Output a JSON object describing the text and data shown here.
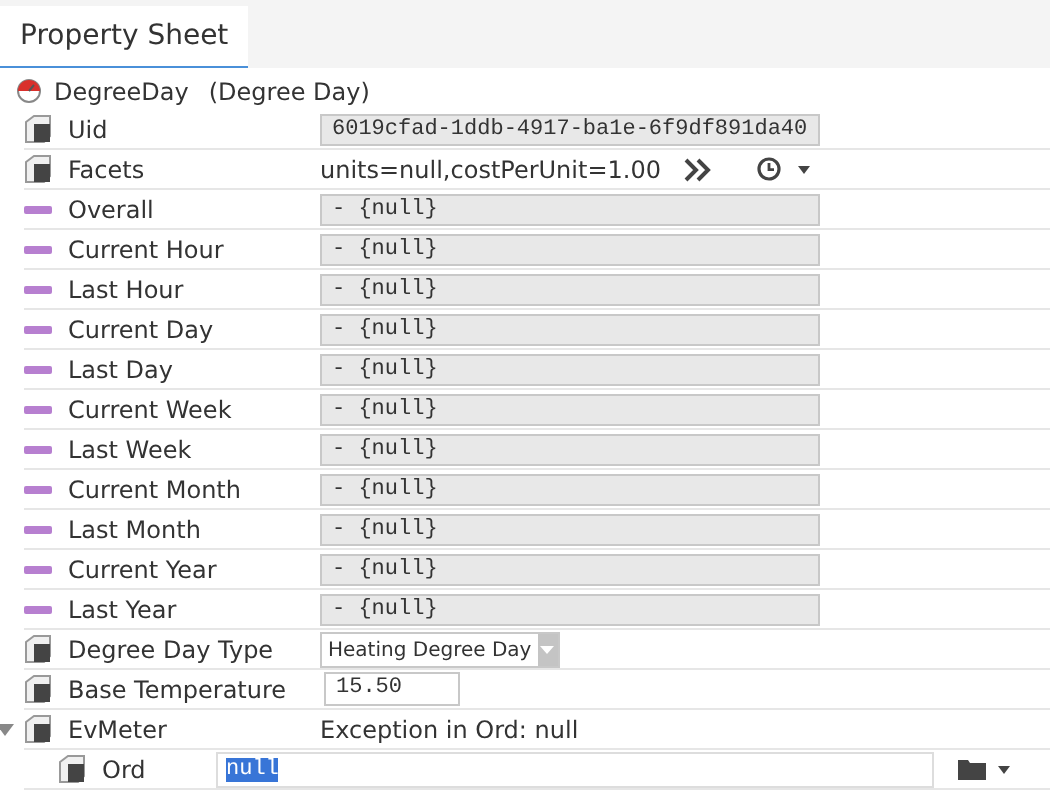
{
  "tabs": [
    {
      "label": "Property Sheet",
      "selected": true
    }
  ],
  "root": {
    "name": "DegreeDay",
    "type": "(Degree Day)"
  },
  "properties": [
    {
      "label": "Uid",
      "kind": "readonly",
      "value": "6019cfad-1ddb-4917-ba1e-6f9df891da40"
    },
    {
      "label": "Facets",
      "kind": "facets",
      "value": "units=null,costPerUnit=1.00"
    },
    {
      "label": "Overall",
      "kind": "slot",
      "value": "- {null}"
    },
    {
      "label": "Current Hour",
      "kind": "slot",
      "value": "- {null}"
    },
    {
      "label": "Last Hour",
      "kind": "slot",
      "value": "- {null}"
    },
    {
      "label": "Current Day",
      "kind": "slot",
      "value": "- {null}"
    },
    {
      "label": "Last Day",
      "kind": "slot",
      "value": "- {null}"
    },
    {
      "label": "Current Week",
      "kind": "slot",
      "value": "- {null}"
    },
    {
      "label": "Last Week",
      "kind": "slot",
      "value": "- {null}"
    },
    {
      "label": "Current Month",
      "kind": "slot",
      "value": "- {null}"
    },
    {
      "label": "Last Month",
      "kind": "slot",
      "value": "- {null}"
    },
    {
      "label": "Current Year",
      "kind": "slot",
      "value": "- {null}"
    },
    {
      "label": "Last Year",
      "kind": "slot",
      "value": "- {null}"
    },
    {
      "label": "Degree Day Type",
      "kind": "select",
      "value": "Heating Degree Day"
    },
    {
      "label": "Base Temperature",
      "kind": "input",
      "value": "15.50"
    },
    {
      "label": "EvMeter",
      "kind": "text",
      "value": "Exception in Ord: null",
      "expanded": true,
      "children": [
        {
          "label": "Ord",
          "kind": "ord",
          "value": "null"
        }
      ]
    }
  ]
}
